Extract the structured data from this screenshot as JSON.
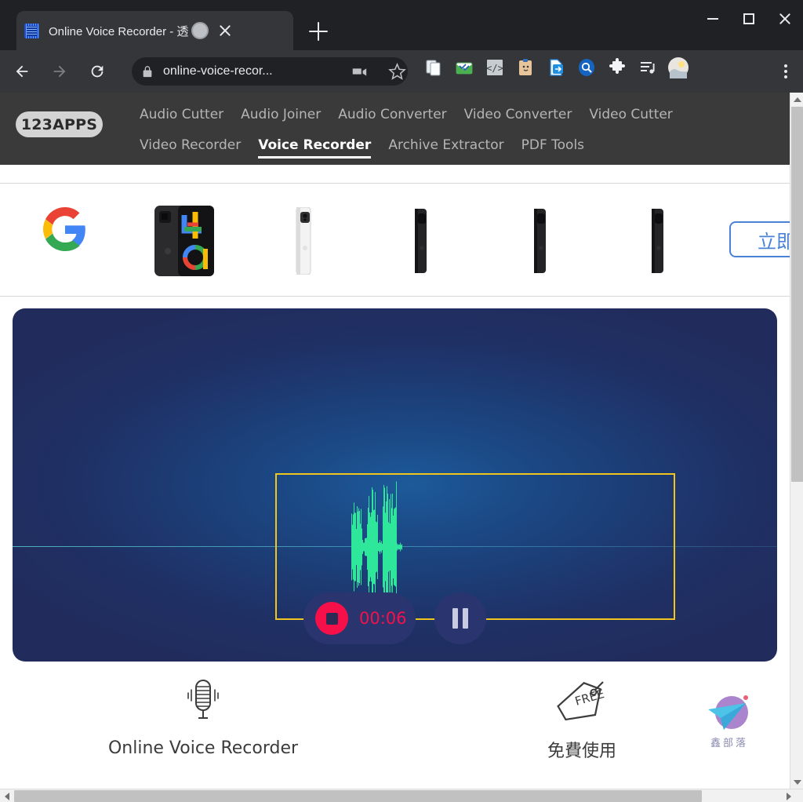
{
  "browser": {
    "tab": {
      "title": "Online Voice Recorder - 透",
      "favicon_name": "chip-favicon",
      "recording_indicator_name": "tab-recording-indicator",
      "close_name": "tab-close-icon"
    },
    "new_tab_label": "+",
    "window_controls": {
      "minimize": "Minimize",
      "maximize": "Maximize",
      "close": "Close"
    },
    "nav": {
      "back": "Back",
      "forward": "Forward",
      "reload": "Reload"
    },
    "omnibox": {
      "url": "online-voice-recor...",
      "lock_icon": "lock-icon",
      "camera_icon": "camera-recording-icon",
      "bookmark_icon": "star-icon"
    },
    "extensions": [
      {
        "name": "copy-documents-extension"
      },
      {
        "name": "green-mail-extension"
      },
      {
        "name": "code-brackets-extension"
      },
      {
        "name": "clipboard-face-extension"
      },
      {
        "name": "blue-export-document-extension"
      },
      {
        "name": "blue-search-extension"
      },
      {
        "name": "puzzle-piece-extension"
      },
      {
        "name": "music-playlist-extension"
      },
      {
        "name": "profile-avatar"
      }
    ],
    "menu_icon": "three-dot-menu-icon"
  },
  "site": {
    "logo": "123APPS",
    "nav_row1": [
      {
        "label": "Audio Cutter",
        "active": false
      },
      {
        "label": "Audio Joiner",
        "active": false
      },
      {
        "label": "Audio Converter",
        "active": false
      },
      {
        "label": "Video Converter",
        "active": false
      },
      {
        "label": "Video Cutter",
        "active": false
      }
    ],
    "nav_row2": [
      {
        "label": "Video Recorder",
        "active": false
      },
      {
        "label": "Voice Recorder",
        "active": true
      },
      {
        "label": "Archive Extractor",
        "active": false
      },
      {
        "label": "PDF Tools",
        "active": false
      }
    ]
  },
  "ad": {
    "brand_icon": "google-logo",
    "cta_label": "立即",
    "products": [
      {
        "name": "pixel-phone-black-front"
      },
      {
        "name": "pixel-phone-white-side"
      },
      {
        "name": "pixel-phone-black-side-1"
      },
      {
        "name": "pixel-phone-black-side-2"
      },
      {
        "name": "pixel-phone-black-side-3"
      }
    ]
  },
  "recorder": {
    "waveform_name": "audio-waveform",
    "selection_box_name": "waveform-selection-box",
    "selection_color": "#f0c520",
    "waveform_color": "#2fe79b",
    "stop_button_label": "Stop",
    "timer": "00:06",
    "timer_color": "#f5104a",
    "pause_button_label": "Pause"
  },
  "features": [
    {
      "icon": "microphone-icon",
      "title": "Online Voice Recorder"
    },
    {
      "icon": "free-price-tag-icon",
      "title": "免費使用"
    }
  ],
  "watermark": {
    "logo": "paper-plane-logo",
    "text": "鑫部落"
  },
  "scrollbars": {
    "vertical": {
      "up": "▲",
      "down": "▼"
    },
    "horizontal": {
      "left": "◀",
      "right": "▶"
    }
  }
}
